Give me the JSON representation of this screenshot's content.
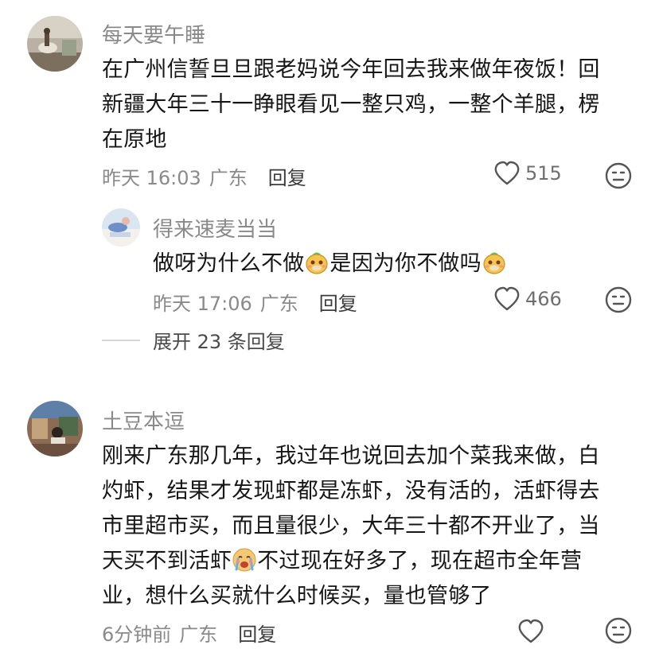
{
  "comments": [
    {
      "username": "每天要午睡",
      "text_lines": [
        "在广州信誓旦旦跟老妈说今年回去我来做年夜饭！回",
        "新疆大年三十一睁眼看见一整只鸡，一整个羊腿，楞",
        "在原地"
      ],
      "time": "昨天 16:03",
      "location": "广东",
      "reply_label": "回复",
      "likes": "515",
      "like_icon": "heart-outline-icon",
      "dislike_icon": "dislike-face-icon",
      "replies": [
        {
          "username": "得来速麦当当",
          "text_before": "做呀为什么不做",
          "text_after": "是因为你不做吗",
          "emoji": "sticker-emoji",
          "time": "昨天 17:06",
          "location": "广东",
          "reply_label": "回复",
          "likes": "466"
        }
      ],
      "expand_label": "展开 23 条回复"
    },
    {
      "username": "土豆本逗",
      "text_lines": [
        "刚来广东那几年，我过年也说回去加个菜我来做，白",
        "灼虾，结果才发现虾都是冻虾，没有活的，活虾得去",
        "市里超市买，而且量很少，大年三十都不开业了，当"
      ],
      "text_line4_before": "天买不到活虾",
      "text_line4_emoji": "crying-face-emoji",
      "text_line4_after": "不过现在好多了，现在超市全年营",
      "text_line5": "业，想什么买就什么时候买，量也管够了",
      "time": "6分钟前",
      "location": "广东",
      "reply_label": "回复",
      "likes": ""
    }
  ],
  "colors": {
    "text": "#161616",
    "muted": "#8a8a8a",
    "icon": "#555555"
  }
}
